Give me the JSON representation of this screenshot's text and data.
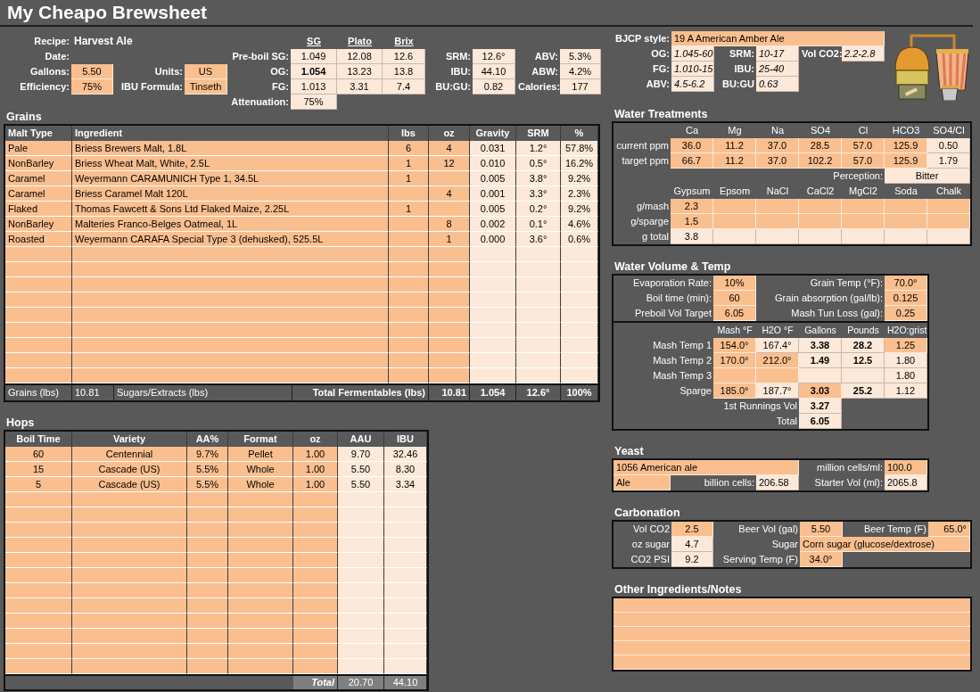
{
  "title": "My Cheapo Brewsheet",
  "summary": {
    "rows": [
      [
        {
          "text": "Recipe:",
          "kind": "label"
        },
        {
          "text": "Harvest Ale",
          "kind": "name"
        },
        {
          "kind": "gap"
        },
        {
          "kind": "gap"
        },
        {
          "kind": "gap"
        },
        {
          "text": "SG",
          "kind": "head"
        },
        {
          "text": "Plato",
          "kind": "head"
        },
        {
          "text": "Brix",
          "kind": "head"
        }
      ],
      [
        {
          "text": "Date:",
          "kind": "label"
        },
        {
          "kind": "gap"
        },
        {
          "kind": "gap"
        },
        {
          "kind": "gap"
        },
        {
          "text": "Pre-boil SG:",
          "kind": "label"
        },
        {
          "text": "1.049",
          "kind": "calc"
        },
        {
          "text": "12.08",
          "kind": "calc"
        },
        {
          "text": "12.6",
          "kind": "calc"
        },
        {
          "text": "SRM:",
          "kind": "label"
        },
        {
          "text": "12.6°",
          "kind": "calc"
        },
        {
          "text": "ABV:",
          "kind": "label"
        },
        {
          "text": "5.3%",
          "kind": "calc"
        }
      ],
      [
        {
          "text": "Gallons:",
          "kind": "label"
        },
        {
          "text": "5.50",
          "kind": "in"
        },
        {
          "text": "Units:",
          "kind": "label"
        },
        {
          "text": "US",
          "kind": "in"
        },
        {
          "text": "OG:",
          "kind": "label"
        },
        {
          "text": "1.054",
          "kind": "calc",
          "bold": true
        },
        {
          "text": "13.23",
          "kind": "calc"
        },
        {
          "text": "13.8",
          "kind": "calc"
        },
        {
          "text": "IBU:",
          "kind": "label"
        },
        {
          "text": "44.10",
          "kind": "calc"
        },
        {
          "text": "ABW:",
          "kind": "label"
        },
        {
          "text": "4.2%",
          "kind": "calc"
        }
      ],
      [
        {
          "text": "Efficiency:",
          "kind": "label"
        },
        {
          "text": "75%",
          "kind": "in"
        },
        {
          "text": "IBU Formula:",
          "kind": "label"
        },
        {
          "text": "Tinseth",
          "kind": "in"
        },
        {
          "text": "FG:",
          "kind": "label"
        },
        {
          "text": "1.013",
          "kind": "calc"
        },
        {
          "text": "3.31",
          "kind": "calc"
        },
        {
          "text": "7.4",
          "kind": "calc"
        },
        {
          "text": "BU:GU:",
          "kind": "label"
        },
        {
          "text": "0.82",
          "kind": "calc"
        },
        {
          "text": "Calories:",
          "kind": "label"
        },
        {
          "text": "177",
          "kind": "calc"
        }
      ],
      [
        {
          "kind": "gap"
        },
        {
          "kind": "gap"
        },
        {
          "kind": "gap"
        },
        {
          "kind": "gap"
        },
        {
          "text": "Attenuation:",
          "kind": "label"
        },
        {
          "text": "75%",
          "kind": "calc"
        }
      ]
    ]
  },
  "grains": {
    "title": "Grains",
    "columns": [
      {
        "label": "Malt Type",
        "kind": "in-left"
      },
      {
        "label": "Ingredient",
        "kind": "in-left"
      },
      {
        "label": "lbs",
        "kind": "in"
      },
      {
        "label": "oz",
        "kind": "in"
      },
      {
        "label": "Gravity",
        "kind": "calc"
      },
      {
        "label": "SRM",
        "kind": "calc"
      },
      {
        "label": "%",
        "kind": "calc"
      }
    ],
    "rows": [
      [
        "Pale",
        "Briess Brewers Malt, 1.8L",
        "6",
        "4",
        "0.031",
        "1.2°",
        "57.8%"
      ],
      [
        "NonBarley",
        "Briess Wheat Malt, White, 2.5L",
        "1",
        "12",
        "0.010",
        "0.5°",
        "16.2%"
      ],
      [
        "Caramel",
        "Weyermann CARAMUNICH Type 1, 34.5L",
        "1",
        null,
        "0.005",
        "3.8°",
        "9.2%"
      ],
      [
        "Caramel",
        "Briess Caramel Malt 120L",
        null,
        "4",
        "0.001",
        "3.3°",
        "2.3%"
      ],
      [
        "Flaked",
        "Thomas Fawcett & Sons Ltd Flaked Maize, 2.25L",
        "1",
        null,
        "0.005",
        "0.2°",
        "9.2%"
      ],
      [
        "NonBarley",
        "Malteries Franco-Belges Oatmeal, 1L",
        null,
        "8",
        "0.002",
        "0.1°",
        "4.6%"
      ],
      [
        "Roasted",
        "Weyermann CARAFA Special Type 3 (dehusked), 525.5L",
        null,
        "1",
        "0.000",
        "3.6°",
        "0.6%"
      ]
    ],
    "footer": [
      {
        "text": "Grains (lbs)",
        "kind": "total-left"
      },
      {
        "text": "10.81",
        "kind": "total-left"
      },
      {
        "text": "Sugars/Extracts (lbs)",
        "kind": "total-left"
      },
      {
        "text": "Total Fermentables (lbs)",
        "kind": "total",
        "bold": true
      },
      {
        "text": "10.81",
        "kind": "total",
        "bold": true
      },
      {
        "text": "1.054",
        "kind": "total-center",
        "bold": true
      },
      {
        "text": "12.6°",
        "kind": "total-center",
        "bold": true
      },
      {
        "text": "100%",
        "kind": "total-center",
        "bold": true
      }
    ]
  },
  "hops": {
    "title": "Hops",
    "columns": [
      {
        "label": "Boil Time",
        "kind": "in"
      },
      {
        "label": "Variety",
        "kind": "in"
      },
      {
        "label": "AA%",
        "kind": "in"
      },
      {
        "label": "Format",
        "kind": "in"
      },
      {
        "label": "oz",
        "kind": "in"
      },
      {
        "label": "AAU",
        "kind": "calc"
      },
      {
        "label": "IBU",
        "kind": "calc"
      }
    ],
    "rows": [
      [
        "60",
        "Centennial",
        "9.7%",
        "Pellet",
        "1.00",
        "9.70",
        "32.46"
      ],
      [
        "15",
        "Cascade (US)",
        "5.5%",
        "Whole",
        "1.00",
        "5.50",
        "8.30"
      ],
      [
        "5",
        "Cascade (US)",
        "5.5%",
        "Whole",
        "1.00",
        "5.50",
        "3.34"
      ]
    ],
    "footer": [
      {
        "kind": "gap"
      },
      {
        "kind": "gap"
      },
      {
        "kind": "gap"
      },
      {
        "kind": "gap"
      },
      {
        "text": "Total",
        "kind": "total",
        "bold": true,
        "italic": true
      },
      {
        "text": "20.70",
        "kind": "total-center"
      },
      {
        "text": "44.10",
        "kind": "total-center"
      }
    ]
  },
  "bjcp": {
    "rows": [
      [
        {
          "text": "BJCP style:",
          "kind": "label"
        },
        {
          "text": "19 A American Amber Ale",
          "kind": "in-left"
        }
      ],
      [
        {
          "text": "OG:",
          "kind": "label"
        },
        {
          "text": "1.045-60",
          "kind": "calc-left",
          "italic": true
        },
        {
          "text": "SRM:",
          "kind": "label"
        },
        {
          "text": "10-17",
          "kind": "calc-left",
          "italic": true
        },
        {
          "text": "Vol CO2:",
          "kind": "label"
        },
        {
          "text": "2.2-2.8",
          "kind": "calc-left",
          "italic": true
        }
      ],
      [
        {
          "text": "FG:",
          "kind": "label"
        },
        {
          "text": "1.010-15",
          "kind": "calc-left",
          "italic": true
        },
        {
          "text": "IBU:",
          "kind": "label"
        },
        {
          "text": "25-40",
          "kind": "calc-left",
          "italic": true
        }
      ],
      [
        {
          "text": "ABV:",
          "kind": "label"
        },
        {
          "text": "4.5-6.2",
          "kind": "calc-left",
          "italic": true
        },
        {
          "text": "BU:GU",
          "kind": "label"
        },
        {
          "text": "0.63",
          "kind": "calc-left",
          "italic": true
        }
      ]
    ]
  },
  "water_treatments": {
    "title": "Water Treatments",
    "rows": [
      [
        {
          "kind": "gap"
        },
        {
          "text": "Ca",
          "kind": "head"
        },
        {
          "text": "Mg",
          "kind": "head"
        },
        {
          "text": "Na",
          "kind": "head"
        },
        {
          "text": "SO4",
          "kind": "head"
        },
        {
          "text": "Cl",
          "kind": "head"
        },
        {
          "text": "HCO3",
          "kind": "head"
        },
        {
          "text": "SO4/Cl",
          "kind": "head"
        }
      ],
      [
        {
          "text": "current ppm",
          "kind": "label"
        },
        {
          "text": "36.0",
          "kind": "in"
        },
        {
          "text": "11.2",
          "kind": "in"
        },
        {
          "text": "37.0",
          "kind": "in"
        },
        {
          "text": "28.5",
          "kind": "in"
        },
        {
          "text": "57.0",
          "kind": "in"
        },
        {
          "text": "125.9",
          "kind": "in"
        },
        {
          "text": "0.50",
          "kind": "calc"
        }
      ],
      [
        {
          "text": "target ppm",
          "kind": "label"
        },
        {
          "text": "66.7",
          "kind": "in"
        },
        {
          "text": "11.2",
          "kind": "in"
        },
        {
          "text": "37.0",
          "kind": "in"
        },
        {
          "text": "102.2",
          "kind": "in"
        },
        {
          "text": "57.0",
          "kind": "in"
        },
        {
          "text": "125.9",
          "kind": "in"
        },
        {
          "text": "1.79",
          "kind": "calc"
        }
      ],
      [
        {
          "kind": "gap"
        },
        {
          "kind": "gap"
        },
        {
          "kind": "gap"
        },
        {
          "kind": "gap"
        },
        {
          "kind": "gap"
        },
        {
          "text": "Perception:",
          "kind": "label"
        },
        {
          "text": "Bitter",
          "kind": "calc"
        }
      ],
      [
        {
          "kind": "gap"
        },
        {
          "text": "Gypsum",
          "kind": "head"
        },
        {
          "text": "Epsom",
          "kind": "head"
        },
        {
          "text": "NaCl",
          "kind": "head"
        },
        {
          "text": "CaCl2",
          "kind": "head"
        },
        {
          "text": "MgCl2",
          "kind": "head"
        },
        {
          "text": "Soda",
          "kind": "head"
        },
        {
          "text": "Chalk",
          "kind": "head"
        }
      ],
      [
        {
          "text": "g/mash",
          "kind": "label"
        },
        {
          "text": "2.3",
          "kind": "in"
        },
        {
          "kind": "in"
        },
        {
          "kind": "in"
        },
        {
          "kind": "in"
        },
        {
          "kind": "in"
        },
        {
          "kind": "in"
        },
        {
          "kind": "in"
        }
      ],
      [
        {
          "text": "g/sparge",
          "kind": "label"
        },
        {
          "text": "1.5",
          "kind": "in"
        },
        {
          "kind": "in"
        },
        {
          "kind": "in"
        },
        {
          "kind": "in"
        },
        {
          "kind": "in"
        },
        {
          "kind": "in"
        },
        {
          "kind": "in"
        }
      ],
      [
        {
          "text": "g total",
          "kind": "label"
        },
        {
          "text": "3.8",
          "kind": "calc"
        },
        {
          "kind": "calc"
        },
        {
          "kind": "calc"
        },
        {
          "kind": "calc"
        },
        {
          "kind": "calc"
        },
        {
          "kind": "calc"
        },
        {
          "kind": "calc"
        }
      ]
    ]
  },
  "water_volume": {
    "title": "Water Volume & Temp",
    "settings": [
      [
        {
          "text": "Evaporation Rate:",
          "kind": "label"
        },
        {
          "text": "10%",
          "kind": "in"
        },
        {
          "text": "Grain Temp (°F):",
          "kind": "label"
        },
        {
          "text": "70.0°",
          "kind": "in"
        }
      ],
      [
        {
          "text": "Boil time (min):",
          "kind": "label"
        },
        {
          "text": "60",
          "kind": "in"
        },
        {
          "text": "Grain absorption (gal/lb):",
          "kind": "label"
        },
        {
          "text": "0.125",
          "kind": "in"
        }
      ],
      [
        {
          "text": "Preboil Vol Target",
          "kind": "label"
        },
        {
          "text": "6.05",
          "kind": "in"
        },
        {
          "text": "Mash Tun Loss (gal):",
          "kind": "label"
        },
        {
          "text": "0.25",
          "kind": "in"
        }
      ]
    ],
    "steps": [
      [
        {
          "kind": "gap"
        },
        {
          "text": "Mash °F",
          "kind": "head"
        },
        {
          "text": "H2O °F",
          "kind": "head"
        },
        {
          "text": "Gallons",
          "kind": "head"
        },
        {
          "text": "Pounds",
          "kind": "head"
        },
        {
          "text": "H2O:grist",
          "kind": "head"
        }
      ],
      [
        {
          "text": "Mash Temp 1",
          "kind": "label"
        },
        {
          "text": "154.0°",
          "kind": "in"
        },
        {
          "text": "167.4°",
          "kind": "calc"
        },
        {
          "text": "3.38",
          "kind": "calc",
          "bold": true
        },
        {
          "text": "28.2",
          "kind": "calc",
          "bold": true
        },
        {
          "text": "1.25",
          "kind": "in"
        }
      ],
      [
        {
          "text": "Mash Temp 2",
          "kind": "label"
        },
        {
          "text": "170.0°",
          "kind": "in"
        },
        {
          "text": "212.0°",
          "kind": "in"
        },
        {
          "text": "1.49",
          "kind": "calc",
          "bold": true
        },
        {
          "text": "12.5",
          "kind": "calc",
          "bold": true
        },
        {
          "text": "1.80",
          "kind": "calc"
        }
      ],
      [
        {
          "text": "Mash Temp 3",
          "kind": "label"
        },
        {
          "kind": "in"
        },
        {
          "kind": "in"
        },
        {
          "kind": "calc"
        },
        {
          "kind": "calc"
        },
        {
          "text": "1.80",
          "kind": "calc"
        }
      ],
      [
        {
          "text": "Sparge",
          "kind": "label"
        },
        {
          "text": "185.0°",
          "kind": "in"
        },
        {
          "text": "187.7°",
          "kind": "calc"
        },
        {
          "text": "3.03",
          "kind": "in",
          "bold": true
        },
        {
          "text": "25.2",
          "kind": "calc",
          "bold": true
        },
        {
          "text": "1.12",
          "kind": "calc"
        }
      ],
      [
        {
          "kind": "gap"
        },
        {
          "kind": "gap"
        },
        {
          "text": "1st Runnings Vol",
          "kind": "label"
        },
        {
          "text": "3.27",
          "kind": "calc",
          "bold": true
        }
      ],
      [
        {
          "kind": "gap"
        },
        {
          "kind": "gap"
        },
        {
          "text": "Total",
          "kind": "label"
        },
        {
          "text": "6.05",
          "kind": "calc",
          "bold": true
        }
      ]
    ]
  },
  "yeast": {
    "title": "Yeast",
    "rows": [
      [
        {
          "text": "1056 American ale",
          "kind": "in-left"
        },
        {
          "kind": "gap"
        },
        {
          "kind": "gap"
        },
        {
          "text": "million cells/ml:",
          "kind": "label"
        },
        {
          "text": "100.0",
          "kind": "in-left"
        }
      ],
      [
        {
          "text": "Ale",
          "kind": "in-left"
        },
        {
          "text": "billion cells:",
          "kind": "label"
        },
        {
          "text": "206.58",
          "kind": "calc-left"
        },
        {
          "text": "Starter Vol (ml):",
          "kind": "label"
        },
        {
          "text": "2065.8",
          "kind": "calc-left"
        }
      ]
    ]
  },
  "carbonation": {
    "title": "Carbonation",
    "rows": [
      [
        {
          "text": "Vol CO2",
          "kind": "label"
        },
        {
          "text": "2.5",
          "kind": "in"
        },
        {
          "text": "Beer Vol (gal)",
          "kind": "label"
        },
        {
          "text": "5.50",
          "kind": "in"
        },
        {
          "text": "Beer Temp (F)",
          "kind": "label"
        },
        {
          "text": "65.0°",
          "kind": "in-right"
        }
      ],
      [
        {
          "text": "oz sugar",
          "kind": "label"
        },
        {
          "text": "4.7",
          "kind": "calc"
        },
        {
          "text": "Sugar",
          "kind": "label"
        },
        {
          "text": "Corn sugar (glucose/dextrose)",
          "kind": "in-left"
        }
      ],
      [
        {
          "text": "CO2 PSI",
          "kind": "label"
        },
        {
          "text": "9.2",
          "kind": "calc"
        },
        {
          "text": "Serving Temp (F)",
          "kind": "label"
        },
        {
          "text": "34.0°",
          "kind": "in"
        }
      ]
    ]
  },
  "notes": {
    "title": "Other Ingredients/Notes"
  }
}
